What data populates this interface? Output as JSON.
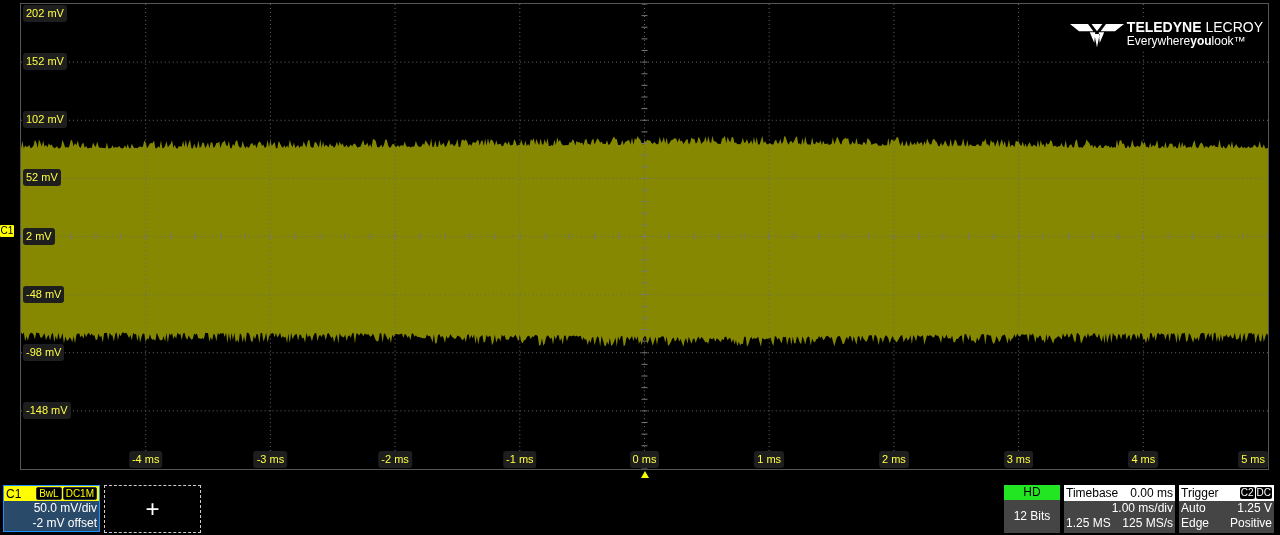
{
  "plot": {
    "y_labels": [
      "202 mV",
      "152 mV",
      "102 mV",
      "52 mV",
      "2 mV",
      "-48 mV",
      "-98 mV",
      "-148 mV"
    ],
    "x_labels": [
      "-4 ms",
      "-3 ms",
      "-2 ms",
      "-1 ms",
      "0 ms",
      "1 ms",
      "2 ms",
      "3 ms",
      "4 ms",
      "5 ms"
    ],
    "channel_marker": "C1",
    "logo": {
      "brand": "**TELEDYNE** LECROY",
      "tagline": "Everywhere**you**look™"
    }
  },
  "channel": {
    "label": "C1",
    "tags": [
      "BwL",
      "DC1M"
    ],
    "scale": "50.0 mV/div",
    "offset": "-2 mV offset"
  },
  "add_button": "+",
  "hd": {
    "title": "HD",
    "bits": "12 Bits"
  },
  "timebase": {
    "title": "Timebase",
    "delay": "0.00 ms",
    "per_div": "1.00 ms/div",
    "samples": "1.25 MS",
    "rate": "125 MS/s"
  },
  "trigger": {
    "title": "Trigger",
    "tags": [
      "C2",
      "DC"
    ],
    "mode": "Auto",
    "level": "1.25 V",
    "type": "Edge",
    "slope": "Positive"
  }
}
